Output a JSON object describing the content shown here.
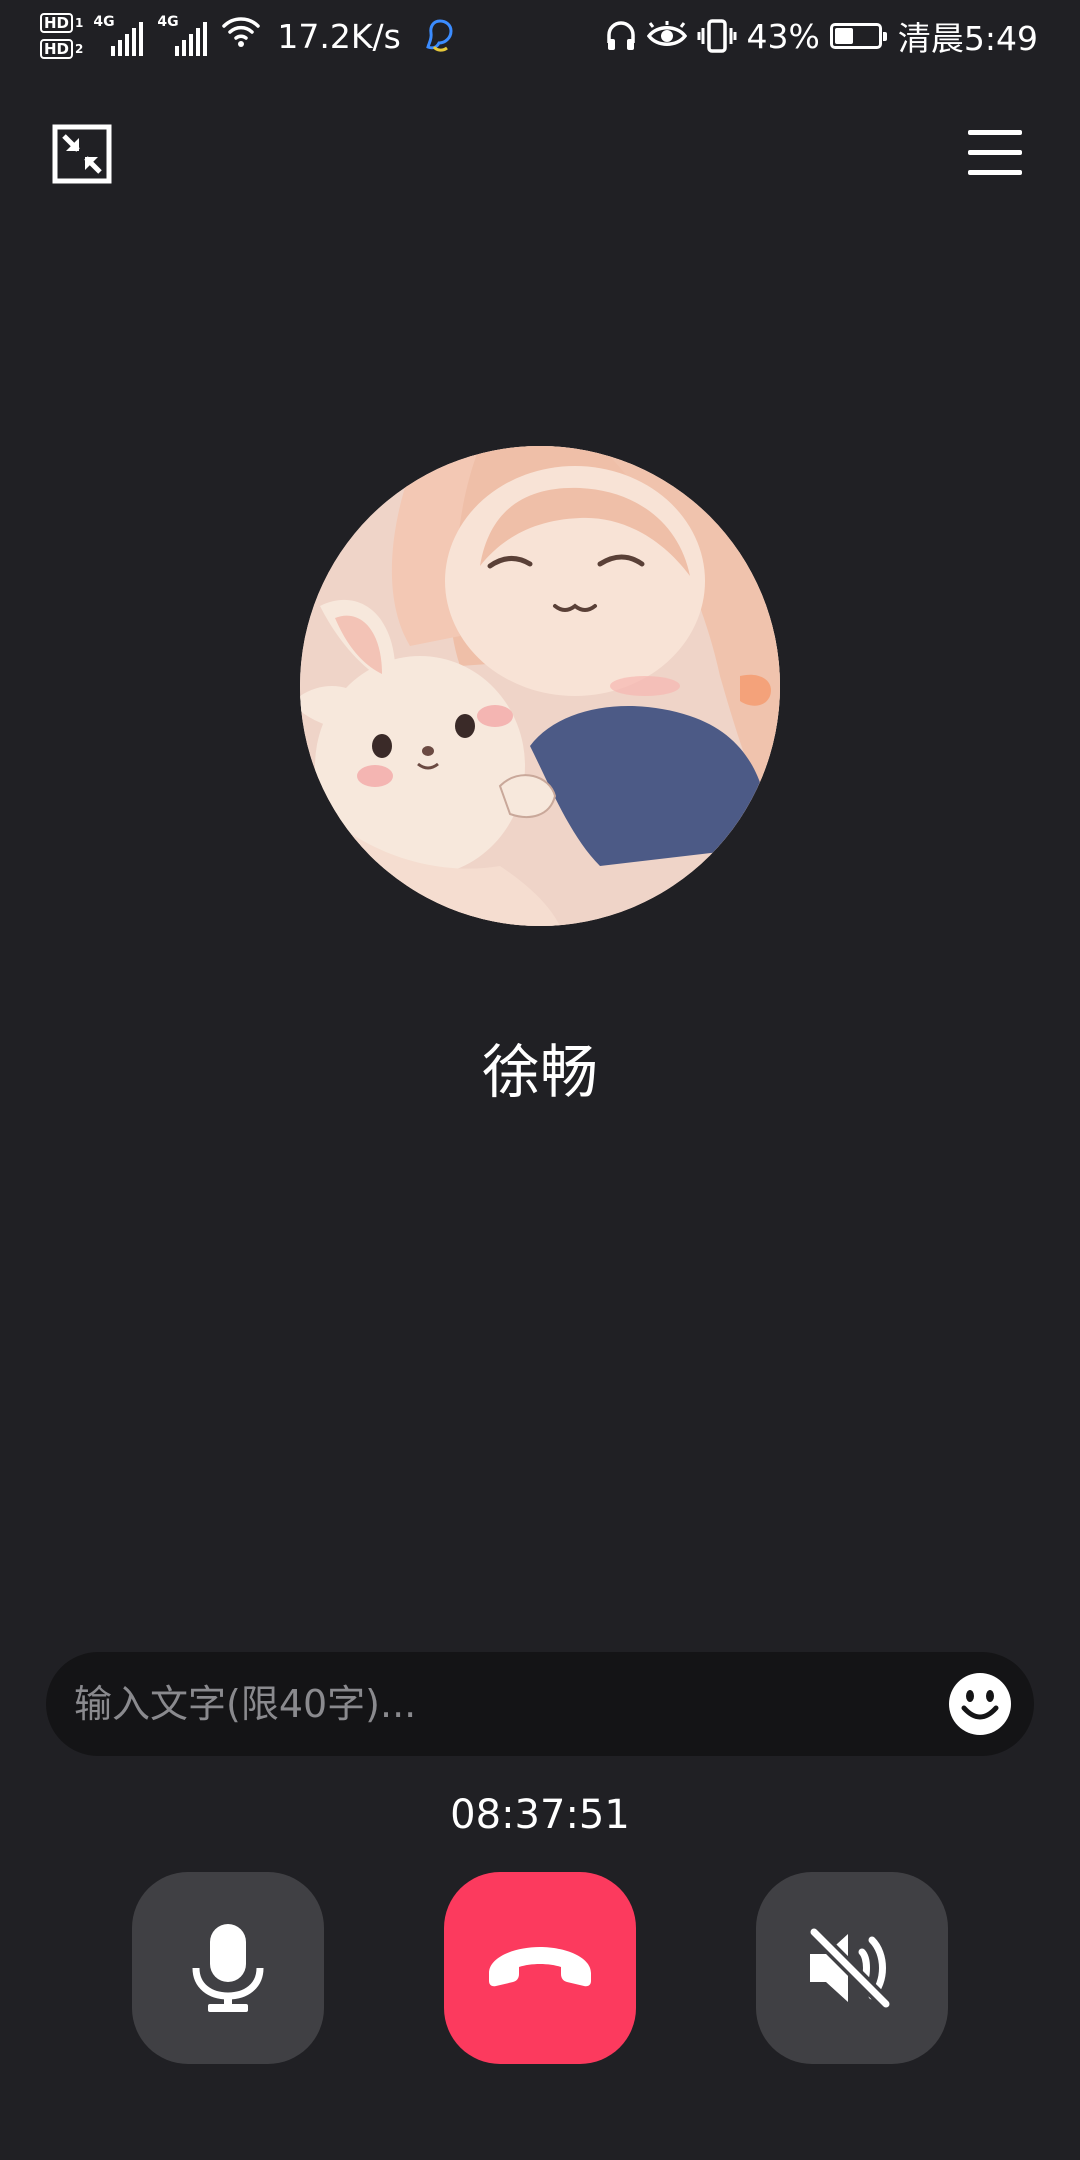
{
  "status_bar": {
    "sim1_label": "HD",
    "sim1_index": "1",
    "sim2_label": "HD",
    "sim2_index": "2",
    "network1": "4G",
    "network2": "4G",
    "net_speed": "17.2K/s",
    "battery_percent": "43%",
    "battery_level": 0.43,
    "time": "清晨5:49",
    "icons": [
      "hd-icon",
      "signal-icon",
      "wifi-icon",
      "app-notification-icon",
      "headphones-icon",
      "eye-icon",
      "vibrate-icon",
      "battery-icon"
    ]
  },
  "top_bar": {
    "left_icon": "minimize-window-icon",
    "right_icon": "menu-icon"
  },
  "caller": {
    "avatar_icon": "avatar-image",
    "name": "徐畅"
  },
  "message_bar": {
    "placeholder": "输入文字(限40字)...",
    "value": "",
    "emoji_icon": "emoji-smile-icon"
  },
  "call": {
    "duration": "08:37:51"
  },
  "controls": {
    "mute_icon": "microphone-icon",
    "hangup_icon": "hang-up-icon",
    "speaker_icon": "speaker-off-icon"
  },
  "colors": {
    "background": "#202024",
    "input_background": "#141416",
    "button_background": "#404044",
    "hangup": "#fc3a5e",
    "text": "#ffffff",
    "placeholder": "#8a8a8e"
  }
}
